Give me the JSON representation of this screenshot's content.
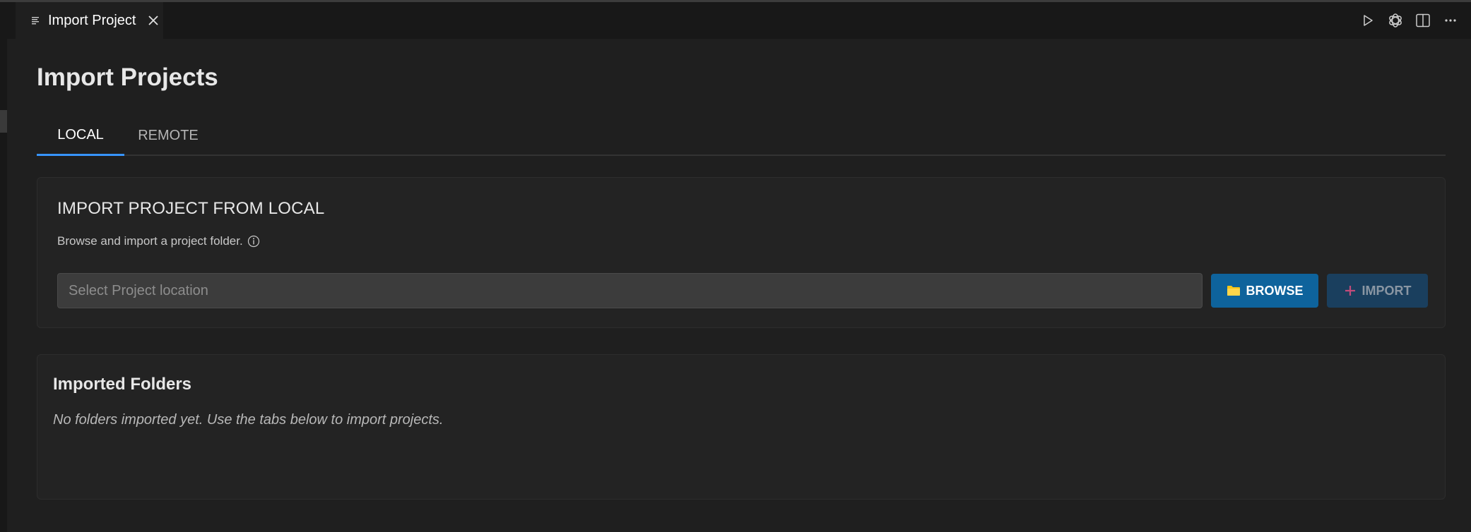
{
  "editor": {
    "tab": {
      "label": "Import Project",
      "icon": "preview-lines-icon",
      "close_icon": "close-icon"
    },
    "actions": [
      {
        "name": "run-button",
        "icon": "play-icon"
      },
      {
        "name": "openai-button",
        "icon": "openai-logo-icon"
      },
      {
        "name": "split-editor-button",
        "icon": "split-editor-icon"
      },
      {
        "name": "more-actions-button",
        "icon": "ellipsis-icon"
      }
    ]
  },
  "page": {
    "title": "Import Projects",
    "tabs": [
      {
        "label": "LOCAL",
        "active": true
      },
      {
        "label": "REMOTE",
        "active": false
      }
    ]
  },
  "local": {
    "title": "IMPORT PROJECT FROM LOCAL",
    "description": "Browse and import a project folder.",
    "input_value": "",
    "input_placeholder": "Select Project location",
    "browse_label": "BROWSE",
    "import_label": "IMPORT"
  },
  "folders": {
    "title": "Imported Folders",
    "empty_message": "No folders imported yet. Use the tabs below to import projects."
  },
  "colors": {
    "background": "#1f1f1f",
    "tab_bar": "#181818",
    "card": "#232323",
    "accent": "#3794ff",
    "browse_button": "#0e639c",
    "import_button_disabled": "#1a3f5e",
    "folder_icon": "#f5c518",
    "plus_icon": "#c24b7a"
  }
}
